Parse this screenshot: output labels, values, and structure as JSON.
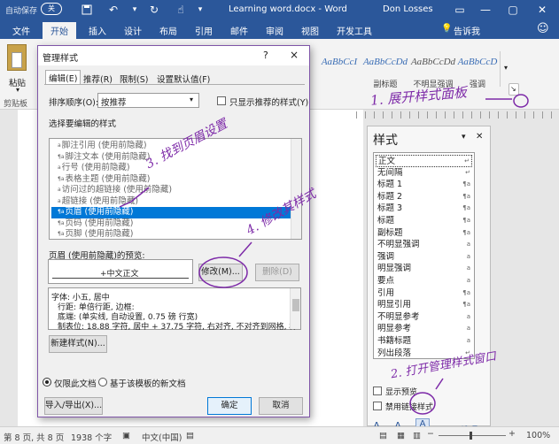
{
  "titlebar": {
    "autosave": "自动保存",
    "autosave_state": "关",
    "doc_title": "Learning word.docx - Word",
    "user": "Don Losses"
  },
  "tabs": [
    "文件",
    "开始",
    "插入",
    "设计",
    "布局",
    "引用",
    "邮件",
    "审阅",
    "视图",
    "开发工具"
  ],
  "tell_me": "告诉我",
  "ribbon": {
    "paste": "粘贴",
    "clipboard": "剪贴板",
    "styles": [
      {
        "preview": "AaBbCcI",
        "label": ""
      },
      {
        "preview": "AaBbCcDd",
        "label": "副标题"
      },
      {
        "preview": "AaBbCcDd",
        "label": "不明显强调"
      },
      {
        "preview": "AaBbCcD",
        "label": "强调"
      }
    ]
  },
  "styles_pane": {
    "title": "样式",
    "items": [
      {
        "name": "正文",
        "mark": "↵"
      },
      {
        "name": "无间隔",
        "mark": "↵"
      },
      {
        "name": "标题 1",
        "mark": "¶a"
      },
      {
        "name": "标题 2",
        "mark": "¶a"
      },
      {
        "name": "标题 3",
        "mark": "¶a"
      },
      {
        "name": "标题",
        "mark": "¶a"
      },
      {
        "name": "副标题",
        "mark": "¶a"
      },
      {
        "name": "不明显强调",
        "mark": "a"
      },
      {
        "name": "强调",
        "mark": "a"
      },
      {
        "name": "明显强调",
        "mark": "a"
      },
      {
        "name": "要点",
        "mark": "a"
      },
      {
        "name": "引用",
        "mark": "¶a"
      },
      {
        "name": "明显引用",
        "mark": "¶a"
      },
      {
        "name": "不明显参考",
        "mark": "a"
      },
      {
        "name": "明显参考",
        "mark": "a"
      },
      {
        "name": "书籍标题",
        "mark": "a"
      },
      {
        "name": "列出段落",
        "mark": "↵"
      }
    ],
    "show_preview": "显示预览",
    "disable_linked": "禁用链接样式",
    "options": "选项..."
  },
  "dialog": {
    "title": "管理样式",
    "help": "?",
    "close": "×",
    "tabs": [
      "编辑(E)",
      "推荐(R)",
      "限制(S)",
      "设置默认值(F)"
    ],
    "sort_label": "排序顺序(O):",
    "sort_value": "按推荐",
    "only_recommended": "只显示推荐的样式(Y)",
    "choose_label": "选择要编辑的样式",
    "styles": [
      {
        "prefix": "a",
        "name": "脚注引用 (使用前隐藏)"
      },
      {
        "prefix": "¶a",
        "name": "脚注文本 (使用前隐藏)"
      },
      {
        "prefix": "a",
        "name": "行号 (使用前隐藏)"
      },
      {
        "prefix": "¶a",
        "name": "表格主题 (使用前隐藏)"
      },
      {
        "prefix": "a",
        "name": "访问过的超链接 (使用前隐藏)"
      },
      {
        "prefix": "a",
        "name": "超链接 (使用前隐藏)"
      },
      {
        "prefix": "¶a",
        "name": "页眉 (使用前隐藏)",
        "selected": true
      },
      {
        "prefix": "¶a",
        "name": "页码 (使用前隐藏)"
      },
      {
        "prefix": "¶a",
        "name": "页脚 (使用前隐藏)"
      }
    ],
    "preview_label": "页眉 (使用前隐藏)的预览:",
    "preview_text": "+中文正文",
    "modify": "修改(M)...",
    "delete": "删除(D)",
    "desc": [
      "字体: 小五, 居中",
      "行距: 单倍行距, 边框:",
      "底端: (单实线, 自动设置, 0.75 磅 行宽)",
      "制表位: 18.88 字符, 居中 + 37.75 字符, 右对齐, 不对齐到网格, 样"
    ],
    "new_style": "新建样式(N)...",
    "only_this_doc": "仅限此文档",
    "new_docs_template": "基于该模板的新文档",
    "import_export": "导入/导出(X)...",
    "ok": "确定",
    "cancel": "取消"
  },
  "annotations": {
    "a1": "1. 展开样式面板",
    "a2": "2. 打开管理样式窗口",
    "a3": "3. 找到页眉设置",
    "a4": "4. 修改其样式"
  },
  "statusbar": {
    "page": "第 8 页, 共 8 页",
    "words": "1938 个字",
    "lang": "中文(中国)",
    "zoom": "100%"
  },
  "colors": {
    "accent": "#2b579a",
    "annotation": "#7d2aa8",
    "selection": "#0078d7"
  }
}
